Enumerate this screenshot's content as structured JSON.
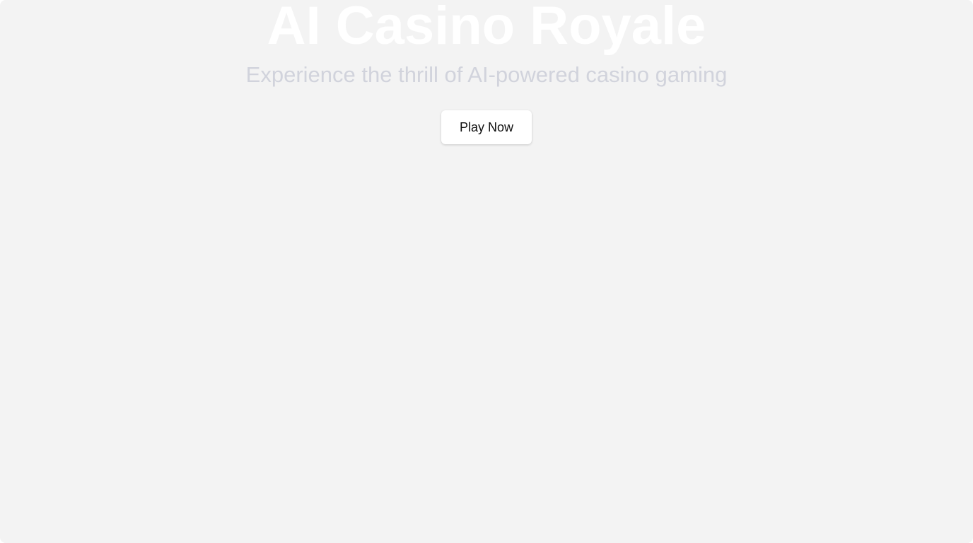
{
  "hero": {
    "title": "AI Casino Royale",
    "subtitle": "Experience the thrill of AI-powered casino gaming",
    "cta_label": "Play Now"
  },
  "colors": {
    "background": "#f3f3f3",
    "title": "#ffffff",
    "subtitle": "#d1d3dc",
    "button_bg": "#ffffff",
    "button_text": "#111111"
  }
}
